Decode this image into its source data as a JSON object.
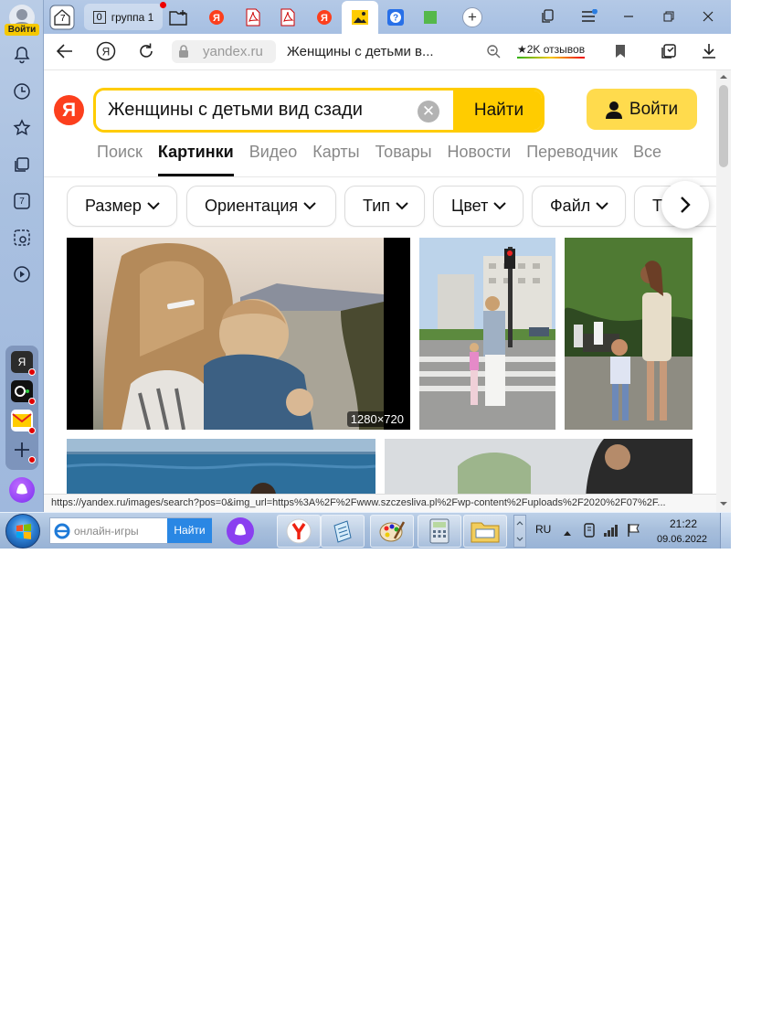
{
  "left_panel": {
    "login_badge": "Войти",
    "side_app_label": "Я",
    "counter_label": "7"
  },
  "tabs": {
    "home_counter": "7",
    "group_count": "0",
    "group_label": "группа 1",
    "new_tab": "+"
  },
  "toolbar": {
    "url": "yandex.ru",
    "page_title": "Женщины с детьми в...",
    "reviews": "★2K отзывов"
  },
  "search": {
    "logo": "Я",
    "query": "Женщины с детьми вид сзади",
    "submit_label": "Найти",
    "login_label": "Войти"
  },
  "services": [
    "Поиск",
    "Картинки",
    "Видео",
    "Карты",
    "Товары",
    "Новости",
    "Переводчик",
    "Все"
  ],
  "active_service": "Картинки",
  "filters": [
    "Размер",
    "Ориентация",
    "Тип",
    "Цвет",
    "Файл",
    "Т"
  ],
  "results": {
    "first_size_label": "1280×720"
  },
  "status_url": "https://yandex.ru/images/search?pos=0&img_url=https%3A%2F%2Fwww.szczesliva.pl%2Fwp-content%2Fuploads%2F2020%2F07%2F...",
  "taskbar": {
    "search_placeholder": "онлайн-игры",
    "search_button": "Найти",
    "lang": "RU",
    "time": "21:22",
    "date": "09.06.2022"
  }
}
